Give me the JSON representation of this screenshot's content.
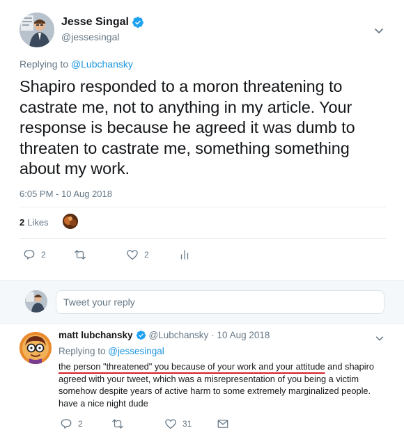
{
  "main_tweet": {
    "author_name": "Jesse Singal",
    "author_handle": "@jessesingal",
    "replying_prefix": "Replying to ",
    "replying_to": "@Lubchansky",
    "text": "Shapiro responded to a moron threatening to castrate me, not to anything in my article. Your response is because he agreed it was dumb to threaten to castrate me, something something about my work.",
    "timestamp": "6:05 PM - 10 Aug 2018",
    "likes_count": "2",
    "likes_label": "Likes",
    "actions": {
      "reply_count": "2",
      "retweet_count": "",
      "like_count": "2"
    }
  },
  "composer": {
    "placeholder": "Tweet your reply"
  },
  "reply_tweet": {
    "author_name": "matt lubchansky",
    "author_handle": "@Lubchansky",
    "date": "· 10 Aug 2018",
    "replying_prefix": "Replying to ",
    "replying_to": "@jessesingal",
    "text_underlined": "the person \"threatened\" you because of your work and your attitude",
    "text_rest": " and shapiro agreed with your tweet, which was a misrepresentation of you being a victim somehow despite years of active harm to some extremely marginalized people. have a nice night dude",
    "actions": {
      "reply_count": "2",
      "retweet_count": "",
      "like_count": "31"
    }
  },
  "colors": {
    "accent": "#1b95e0",
    "verified": "#1da1f2",
    "muted": "#657786",
    "underline": "#d61f26"
  },
  "icons": [
    "verified-icon",
    "chevron-down-icon",
    "reply-icon",
    "retweet-icon",
    "like-icon",
    "analytics-icon",
    "direct-message-icon"
  ]
}
